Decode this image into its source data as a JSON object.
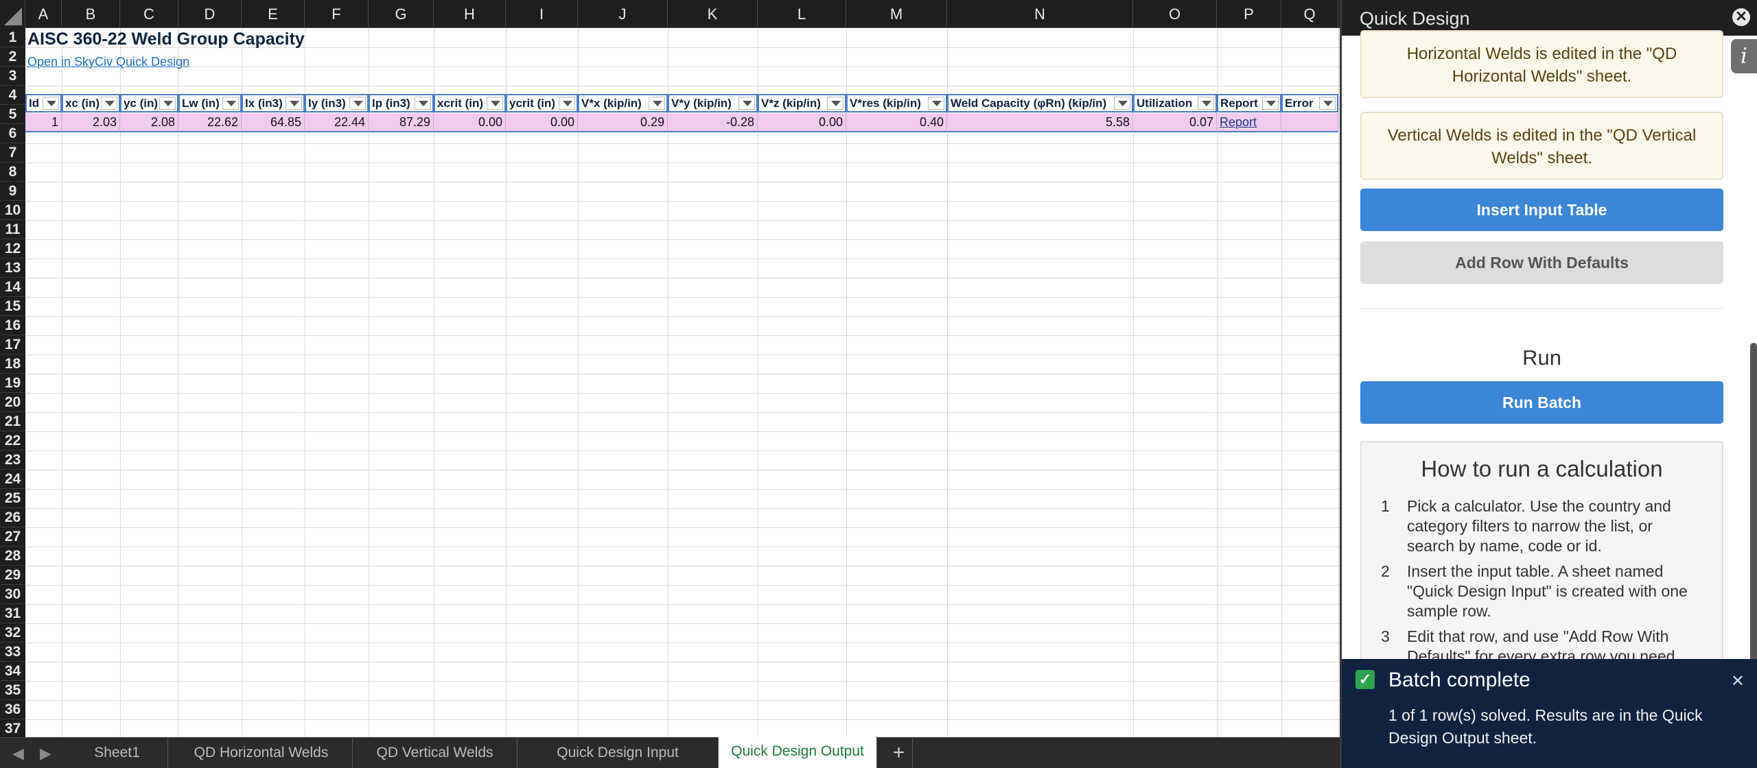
{
  "sheet": {
    "columns": [
      "A",
      "B",
      "C",
      "D",
      "E",
      "F",
      "G",
      "H",
      "I",
      "J",
      "K",
      "L",
      "M",
      "N",
      "O",
      "P",
      "Q"
    ],
    "rows": [
      "1",
      "2",
      "3",
      "4",
      "5",
      "6",
      "7",
      "8",
      "9",
      "10",
      "11",
      "12",
      "13",
      "14",
      "15",
      "16",
      "17",
      "18",
      "19",
      "20",
      "21",
      "22",
      "23",
      "24",
      "25",
      "26",
      "27",
      "28",
      "29",
      "30",
      "31",
      "32",
      "33",
      "34",
      "35",
      "36",
      "37"
    ],
    "title": "AISC 360-22 Weld Group Capacity",
    "link_text": "Open in SkyCiv Quick Design",
    "table": {
      "headers": [
        "Id",
        "xc (in)",
        "yc (in)",
        "Lw (in)",
        "Ix (in3)",
        "Iy (in3)",
        "Ip (in3)",
        "xcrit (in)",
        "ycrit (in)",
        "V*x (kip/in)",
        "V*y (kip/in)",
        "V*z (kip/in)",
        "V*res (kip/in)",
        "Weld Capacity (φRn) (kip/in)",
        "Utilization",
        "Report",
        "Error"
      ],
      "row": [
        "1",
        "2.03",
        "2.08",
        "22.62",
        "64.85",
        "22.44",
        "87.29",
        "0.00",
        "0.00",
        "0.29",
        "-0.28",
        "0.00",
        "0.40",
        "5.58",
        "0.07",
        "Report",
        ""
      ]
    }
  },
  "tabs": {
    "items": [
      "Sheet1",
      "QD Horizontal Welds",
      "QD Vertical Welds",
      "Quick Design Input",
      "Quick Design Output"
    ],
    "active": "Quick Design Output",
    "add_label": "+"
  },
  "panel": {
    "title": "Quick Design",
    "close_glyph": "✕",
    "info_glyph": "i",
    "notes": [
      "Horizontal Welds is edited in the \"QD Horizontal Welds\" sheet.",
      "Vertical Welds is edited in the \"QD Vertical Welds\" sheet."
    ],
    "insert_button": "Insert Input Table",
    "add_row_button": "Add Row With Defaults",
    "run_heading": "Run",
    "run_button": "Run Batch",
    "howto": {
      "title": "How to run a calculation",
      "steps": [
        {
          "num": "1",
          "text": "Pick a calculator. Use the country and category filters to narrow the list, or search by name, code or id."
        },
        {
          "num": "2",
          "text": "Insert the input table. A sheet named \"Quick Design Input\" is created with one sample row."
        },
        {
          "num": "3",
          "text": "Edit that row, and use \"Add Row With Defaults\" for every extra row you need."
        }
      ]
    }
  },
  "toast": {
    "title": "Batch complete",
    "body": "1 of 1 row(s) solved. Results are in the Quick Design Output sheet.",
    "close_glyph": "✕",
    "check_glyph": "✓"
  },
  "colors": {
    "accent_blue": "#3b86d6",
    "table_border": "#4b7fc4",
    "row_fill": "#f2ccef",
    "toast_bg": "#102240",
    "active_tab_text": "#1e7b3a"
  }
}
